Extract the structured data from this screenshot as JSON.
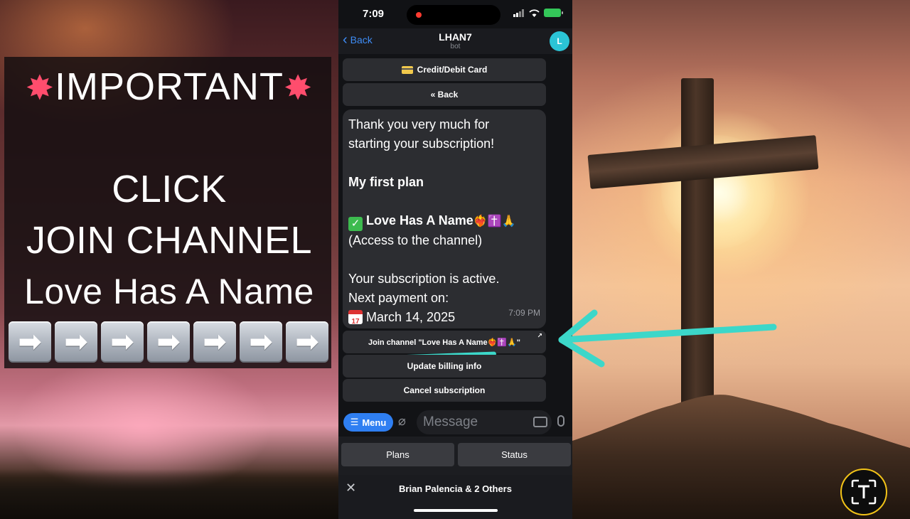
{
  "left_panel": {
    "title": "IMPORTANT",
    "burst_glyph": "✸",
    "line1": "CLICK",
    "line2": "JOIN CHANNEL",
    "line3": "Love Has A Name",
    "arrow_glyph": "➡",
    "arrow_count": 7
  },
  "status_bar": {
    "time": "7:09",
    "battery_color": "#34c759"
  },
  "nav": {
    "back_label": "Back",
    "title": "LHAN7",
    "subtitle": "bot",
    "avatar_letter": "L"
  },
  "chat": {
    "top_buttons": [
      "Credit/Debit Card",
      "« Back"
    ],
    "message": {
      "line1": "Thank you very much for",
      "line2": "starting your subscription!",
      "plan_heading": "My first plan",
      "plan_name": "Love Has A Name",
      "plan_emojis": "❤️‍🔥✝️🙏",
      "plan_desc": "(Access to the channel)",
      "status_line": "Your subscription is active.",
      "next_payment_label": "Next payment on:",
      "next_payment_date": "March 14, 2025",
      "time": "7:09 PM"
    },
    "action_buttons": {
      "join": "Join channel \"Love Has A Name❤️‍🔥✝️🙏\"",
      "update_billing": "Update billing info",
      "cancel": "Cancel subscription"
    }
  },
  "input_bar": {
    "menu_label": "Menu",
    "placeholder": "Message"
  },
  "keyboard_buttons": [
    "Plans",
    "Status"
  ],
  "pinned_bar": {
    "label": "Brian Palencia & 2 Others"
  },
  "colors": {
    "accent_blue": "#2f7ff2",
    "annotation": "#3cd7c9",
    "live_text_ring": "#f2c318"
  }
}
